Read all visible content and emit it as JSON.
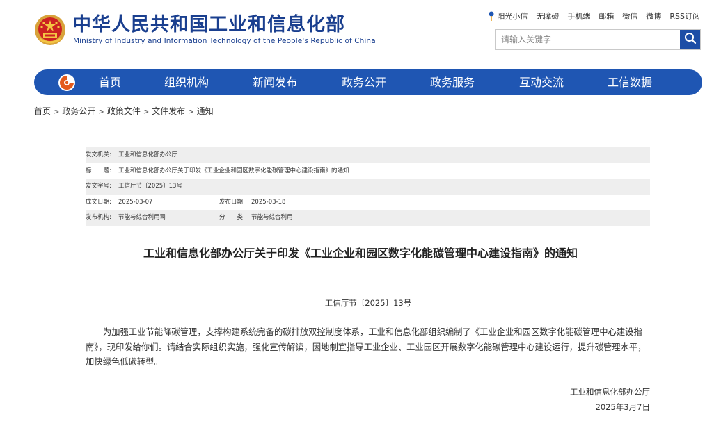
{
  "header": {
    "title": "中华人民共和国工业和信息化部",
    "subtitle": "Ministry of Industry and Information Technology of the People's Republic of China",
    "top_links": [
      "阳光小信",
      "无障碍",
      "手机端",
      "邮箱",
      "微信",
      "微博",
      "RSS订阅"
    ],
    "search_placeholder": "请输入关键字"
  },
  "nav": {
    "items": [
      "首页",
      "组织机构",
      "新闻发布",
      "政务公开",
      "政务服务",
      "互动交流",
      "工信数据"
    ]
  },
  "breadcrumb": [
    "首页",
    "政务公开",
    "政策文件",
    "文件发布",
    "通知"
  ],
  "meta": {
    "issuer_label": "发文机关:",
    "issuer": "工业和信息化部办公厅",
    "title_label": "标　　题:",
    "title": "工业和信息化部办公厅关于印发《工业企业和园区数字化能碳管理中心建设指南》的通知",
    "docno_label": "发文字号:",
    "docno": "工信厅节〔2025〕13号",
    "created_label": "成文日期:",
    "created": "2025-03-07",
    "published_label": "发布日期:",
    "published": "2025-03-18",
    "org_label": "发布机构:",
    "org": "节能与综合利用司",
    "category_label": "分　　类:",
    "category": "节能与综合利用"
  },
  "article": {
    "title": "工业和信息化部办公厅关于印发《工业企业和园区数字化能碳管理中心建设指南》的通知",
    "doc_no": "工信厅节〔2025〕13号",
    "body": "为加强工业节能降碳管理，支撑构建系统完备的碳排放双控制度体系，工业和信息化部组织编制了《工业企业和园区数字化能碳管理中心建设指南》，现印发给你们。请结合实际组织实施，强化宣传解读，因地制宜指导工业企业、工业园区开展数字化能碳管理中心建设运行，提升碳管理水平，加快绿色低碳转型。",
    "signer": "工业和信息化部办公厅",
    "sign_date": "2025年3月7日"
  },
  "colors": {
    "brand_blue": "#1a3f8f",
    "nav_blue": "#1f56b3",
    "search_button": "#1d4ea6",
    "meta_shade": "#eeeeee"
  },
  "icons": {
    "emblem": "national-emblem-icon",
    "pin": "pin-icon",
    "search": "search-icon",
    "nav_logo": "ministry-logo-icon"
  }
}
